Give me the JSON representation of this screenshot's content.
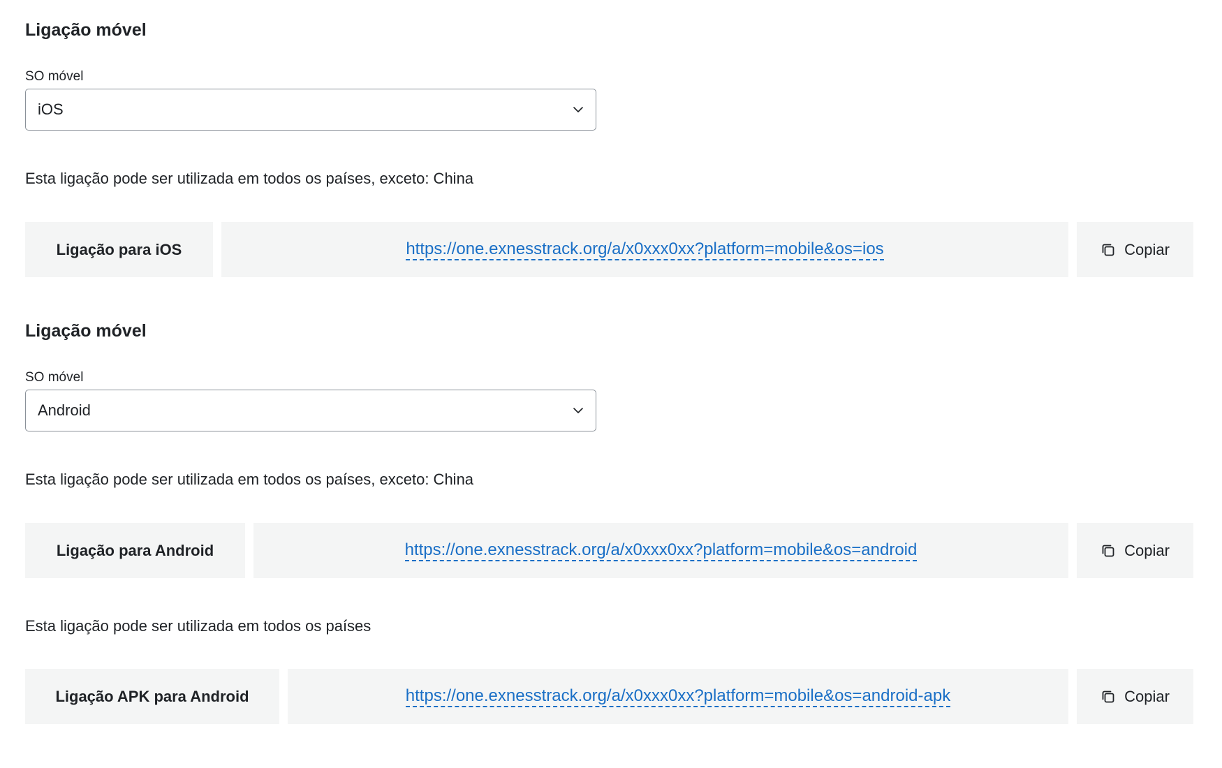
{
  "sections": [
    {
      "title": "Ligação móvel",
      "os_label": "SO móvel",
      "os_selected": "iOS",
      "links": [
        {
          "note": "Esta ligação pode ser utilizada em todos os países, exceto: China",
          "label": "Ligação para iOS",
          "url": "https://one.exnesstrack.org/a/x0xxx0xx?platform=mobile&os=ios",
          "copy_label": "Copiar"
        }
      ]
    },
    {
      "title": "Ligação móvel",
      "os_label": "SO móvel",
      "os_selected": "Android",
      "links": [
        {
          "note": "Esta ligação pode ser utilizada em todos os países, exceto: China",
          "label": "Ligação para Android",
          "url": "https://one.exnesstrack.org/a/x0xxx0xx?platform=mobile&os=android",
          "copy_label": "Copiar"
        },
        {
          "note": "Esta ligação pode ser utilizada em todos os países",
          "label": "Ligação APK para Android",
          "url": "https://one.exnesstrack.org/a/x0xxx0xx?platform=mobile&os=android-apk",
          "copy_label": "Copiar"
        }
      ]
    }
  ],
  "icons": {
    "select_chevron": "chevron-down-icon",
    "copy": "copy-icon"
  },
  "colors": {
    "link": "#1a6fc6",
    "cell_background": "#f4f5f5",
    "text": "#1f2226",
    "select_border": "#8a9199"
  }
}
